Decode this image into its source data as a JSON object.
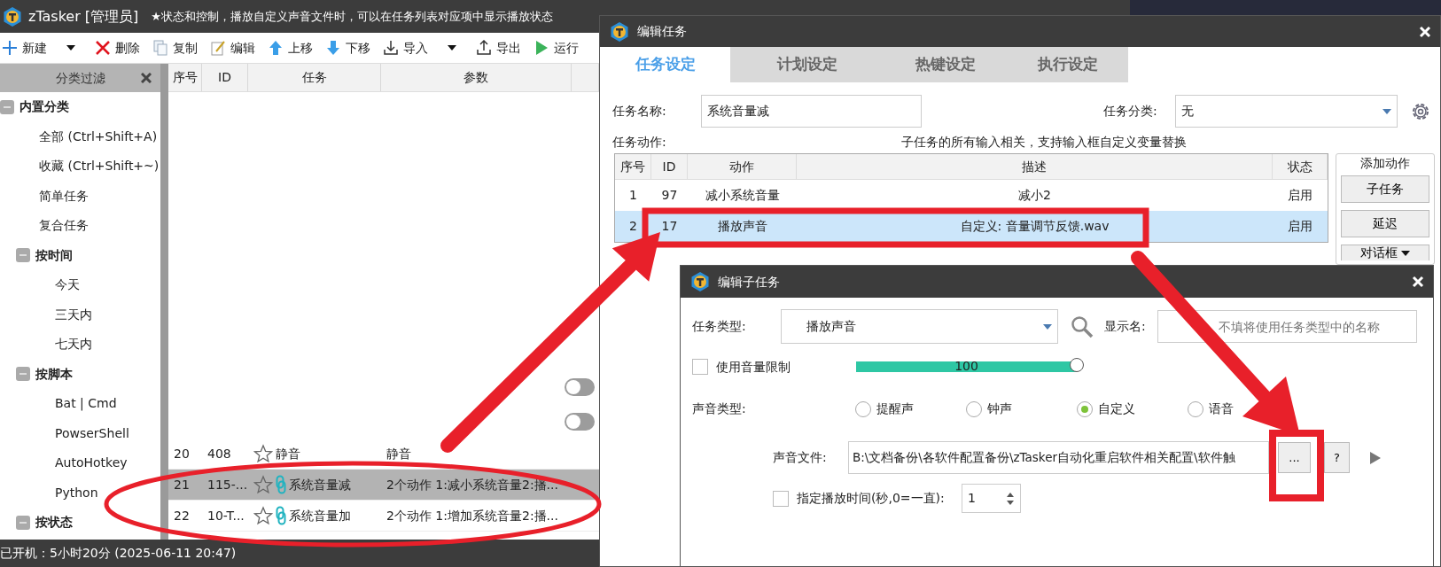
{
  "main_window": {
    "title": "zTasker [管理员]",
    "subtitle": "★状态和控制，播放自定义声音文件时，可以在任务列表对应项中显示播放状态",
    "toolbar": [
      {
        "label": "新建",
        "kind": "new",
        "dropdown": true
      },
      {
        "label": "删除",
        "kind": "delete",
        "dropdown": false
      },
      {
        "label": "复制",
        "kind": "copy",
        "dropdown": false
      },
      {
        "label": "编辑",
        "kind": "edit",
        "dropdown": false
      },
      {
        "label": "上移",
        "kind": "up",
        "dropdown": false
      },
      {
        "label": "下移",
        "kind": "down",
        "dropdown": false
      },
      {
        "label": "导入",
        "kind": "import",
        "dropdown": true
      },
      {
        "label": "导出",
        "kind": "export",
        "dropdown": false
      },
      {
        "label": "运行",
        "kind": "run",
        "dropdown": false
      }
    ],
    "sidebar": {
      "title": "分类过滤",
      "tree": [
        {
          "label": "内置分类",
          "expanded": true,
          "children": [
            {
              "label": "全部 (Ctrl+Shift+A)"
            },
            {
              "label": "收藏 (Ctrl+Shift+~)"
            },
            {
              "label": "简单任务"
            },
            {
              "label": "复合任务"
            },
            {
              "label": "按时间",
              "expanded": true,
              "children": [
                {
                  "label": "今天"
                },
                {
                  "label": "三天内"
                },
                {
                  "label": "七天内"
                }
              ]
            },
            {
              "label": "按脚本",
              "expanded": true,
              "children": [
                {
                  "label": "Bat | Cmd"
                },
                {
                  "label": "PowserShell"
                },
                {
                  "label": "AutoHotkey"
                },
                {
                  "label": "Python"
                }
              ]
            },
            {
              "label": "按状态",
              "expanded": true
            }
          ]
        }
      ]
    },
    "task_list": {
      "columns": [
        "序号",
        "ID",
        "任务",
        "参数"
      ],
      "toggles": [
        {
          "on": false
        },
        {
          "on": false
        }
      ],
      "rows": [
        {
          "num": "20",
          "id": "408",
          "name": "静音",
          "params": "静音",
          "starred": false,
          "linked": false,
          "selected": false
        },
        {
          "num": "21",
          "id": "115-...",
          "name": "系统音量减",
          "params": "2个动作 1:减小系统音量2:播...",
          "starred": false,
          "linked": true,
          "selected": true
        },
        {
          "num": "22",
          "id": "10-T...",
          "name": "系统音量加",
          "params": "2个动作 1:增加系统音量2:播...",
          "starred": false,
          "linked": true,
          "selected": false
        }
      ]
    },
    "status_bar": "已开机：5小时20分 (2025-06-11 20:47)"
  },
  "edit_dialog": {
    "title": "编辑任务",
    "tabs": [
      {
        "label": "任务设定",
        "selected": true
      },
      {
        "label": "计划设定",
        "selected": false
      },
      {
        "label": "热键设定",
        "selected": false
      },
      {
        "label": "执行设定",
        "selected": false
      }
    ],
    "name_label": "任务名称:",
    "name_value": "系统音量减",
    "category_label": "任务分类:",
    "category_value": "无",
    "actions_label": "任务动作:",
    "actions_hint": "子任务的所有输入相关，支持输入框自定义变量替换",
    "columns": [
      "序号",
      "ID",
      "动作",
      "描述",
      "状态"
    ],
    "rows": [
      {
        "cells": [
          "1",
          "97",
          "减小系统音量",
          "减小2",
          "启用"
        ],
        "selected": false
      },
      {
        "cells": [
          "2",
          "17",
          "播放声音",
          "自定义: 音量调节反馈.wav",
          "启用"
        ],
        "selected": true
      }
    ],
    "add_group": {
      "title": "添加动作",
      "buttons": [
        {
          "label": "子任务",
          "dropdown": false
        },
        {
          "label": "延迟",
          "dropdown": false
        },
        {
          "label": "对话框",
          "dropdown": true
        }
      ]
    }
  },
  "sub_dialog": {
    "title": "编辑子任务",
    "type_label": "任务类型:",
    "type_value": "播放声音",
    "display_label": "显示名:",
    "display_placeholder": "不填将使用任务类型中的名称",
    "volume": {
      "label": "使用音量限制",
      "checked": false,
      "level": 1.0,
      "reading": "100"
    },
    "sound_type_label": "声音类型:",
    "sound_types": [
      {
        "label": "提醒声",
        "selected": false
      },
      {
        "label": "钟声",
        "selected": false
      },
      {
        "label": "自定义",
        "selected": true
      },
      {
        "label": "语音",
        "selected": false
      }
    ],
    "file_label": "声音文件:",
    "file_value": "B:\\文档备份\\各软件配置备份\\zTasker自动化重启软件相关配置\\软件触",
    "browse_button": "...",
    "help_button": "?",
    "duration": {
      "label": "指定播放时间(秒,0=一直):",
      "checked": false,
      "value": "1"
    }
  }
}
